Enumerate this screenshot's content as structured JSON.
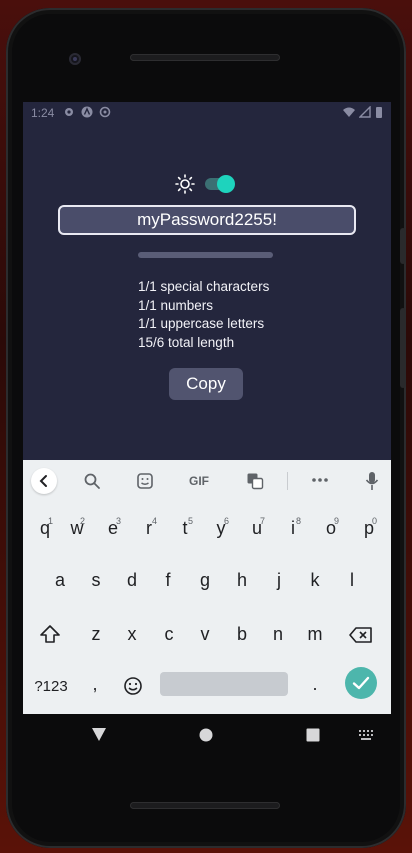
{
  "status_bar": {
    "time": "1:24",
    "icons": [
      "settings-icon",
      "a11y-icon",
      "sync-icon",
      "wifi-icon",
      "signal-icon",
      "battery-icon"
    ]
  },
  "theme_toggle": {
    "icon": "sun-icon",
    "state": "on",
    "accent": "#1ed3bd"
  },
  "password": {
    "value": "myPassword2255!"
  },
  "strength": {
    "fill": 0
  },
  "requirements": [
    "1/1 special characters",
    "1/1 numbers",
    "1/1 uppercase letters",
    "15/6 total length"
  ],
  "copy_button": {
    "label": "Copy"
  },
  "keyboard": {
    "toolbar": {
      "gif_label": "GIF",
      "icons": [
        "back-chevron-icon",
        "search-icon",
        "sticker-icon",
        "gif-icon",
        "translate-icon",
        "more-icon",
        "mic-icon"
      ]
    },
    "row1": [
      "q",
      "w",
      "e",
      "r",
      "t",
      "y",
      "u",
      "i",
      "o",
      "p"
    ],
    "row1_hints": [
      "1",
      "2",
      "3",
      "4",
      "5",
      "6",
      "7",
      "8",
      "9",
      "0"
    ],
    "row2": [
      "a",
      "s",
      "d",
      "f",
      "g",
      "h",
      "j",
      "k",
      "l"
    ],
    "row3": [
      "z",
      "x",
      "c",
      "v",
      "b",
      "n",
      "m"
    ],
    "symbols_label": "?123",
    "comma": ",",
    "period": "."
  },
  "colors": {
    "background": "#24263d",
    "field": "#4a4d6a",
    "button": "#51546f",
    "keyboard": "#edf0f2",
    "enter": "#4db6ac"
  }
}
